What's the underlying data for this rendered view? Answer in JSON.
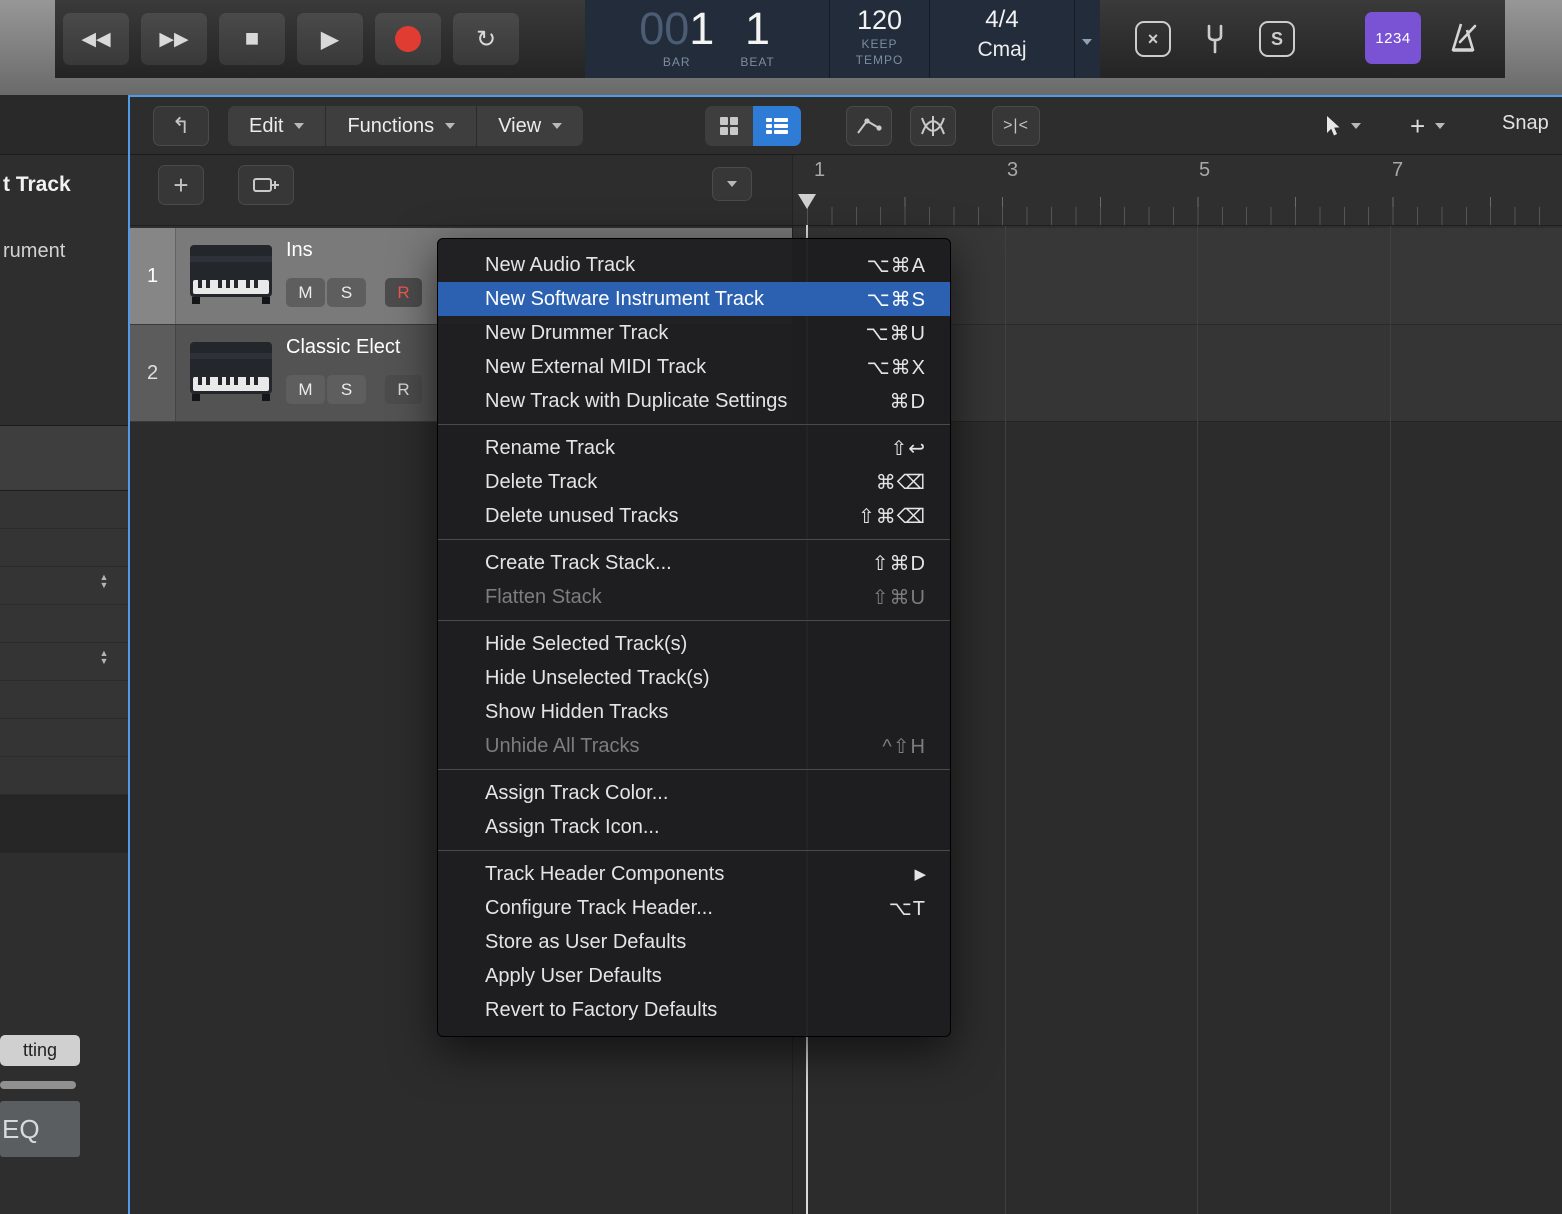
{
  "colors": {
    "selection_blue": "#2c61b2",
    "record_red": "#e03c32",
    "count_in_purple": "#7a52d4",
    "focus_border_blue": "#4f9be8"
  },
  "transport": {
    "icons": {
      "rewind": "◀◀",
      "forward": "▶▶",
      "stop": "■",
      "play": "▶",
      "cycle": "↻",
      "clear": "×"
    },
    "lcd": {
      "bar_dim": "00",
      "bar_lit": "1",
      "beat": "1",
      "bar_label": "BAR",
      "beat_label": "BEAT",
      "tempo": "120",
      "tempo_mode": "KEEP",
      "tempo_label": "TEMPO",
      "time_signature": "4/4",
      "key": "Cmaj"
    },
    "right": {
      "count_in": "1234",
      "solo_box": "S"
    }
  },
  "inspector": {
    "title_partial": "t Track",
    "subtitle_partial": "rument",
    "setting_partial": "tting",
    "eq": "EQ"
  },
  "tracks_toolbar": {
    "menus": [
      {
        "label": "Edit"
      },
      {
        "label": "Functions"
      },
      {
        "label": "View"
      }
    ],
    "snap": "Snap",
    "catch_glyph": ">|<",
    "add_track": "+",
    "plus_tool": "+"
  },
  "ruler": {
    "bars": [
      "1",
      "3",
      "5",
      "7"
    ]
  },
  "track_list": {
    "tracks": [
      {
        "number": "1",
        "name": "Ins",
        "mute": "M",
        "solo": "S",
        "record": "R"
      },
      {
        "number": "2",
        "name": "Classic Elect",
        "mute": "M",
        "solo": "S",
        "record": "R"
      }
    ]
  },
  "context_menu": {
    "items": [
      {
        "label": "New Audio Track",
        "shortcut": "⌥⌘A"
      },
      {
        "label": "New Software Instrument Track",
        "shortcut": "⌥⌘S"
      },
      {
        "label": "New Drummer Track",
        "shortcut": "⌥⌘U"
      },
      {
        "label": "New External MIDI Track",
        "shortcut": "⌥⌘X"
      },
      {
        "label": "New Track with Duplicate Settings",
        "shortcut": "⌘D"
      },
      {
        "label": "Rename Track",
        "shortcut": "⇧↩"
      },
      {
        "label": "Delete Track",
        "shortcut": "⌘⌫"
      },
      {
        "label": "Delete unused Tracks",
        "shortcut": "⇧⌘⌫"
      },
      {
        "label": "Create Track Stack...",
        "shortcut": "⇧⌘D"
      },
      {
        "label": "Flatten Stack",
        "shortcut": "⇧⌘U"
      },
      {
        "label": "Hide Selected Track(s)",
        "shortcut": ""
      },
      {
        "label": "Hide Unselected Track(s)",
        "shortcut": ""
      },
      {
        "label": "Show Hidden Tracks",
        "shortcut": ""
      },
      {
        "label": "Unhide All Tracks",
        "shortcut": "^⇧H"
      },
      {
        "label": "Assign Track Color...",
        "shortcut": ""
      },
      {
        "label": "Assign Track Icon...",
        "shortcut": ""
      },
      {
        "label": "Track Header Components",
        "shortcut": "▶"
      },
      {
        "label": "Configure Track Header...",
        "shortcut": "⌥T"
      },
      {
        "label": "Store as User Defaults",
        "shortcut": ""
      },
      {
        "label": "Apply User Defaults",
        "shortcut": ""
      },
      {
        "label": "Revert to Factory Defaults",
        "shortcut": ""
      }
    ]
  }
}
